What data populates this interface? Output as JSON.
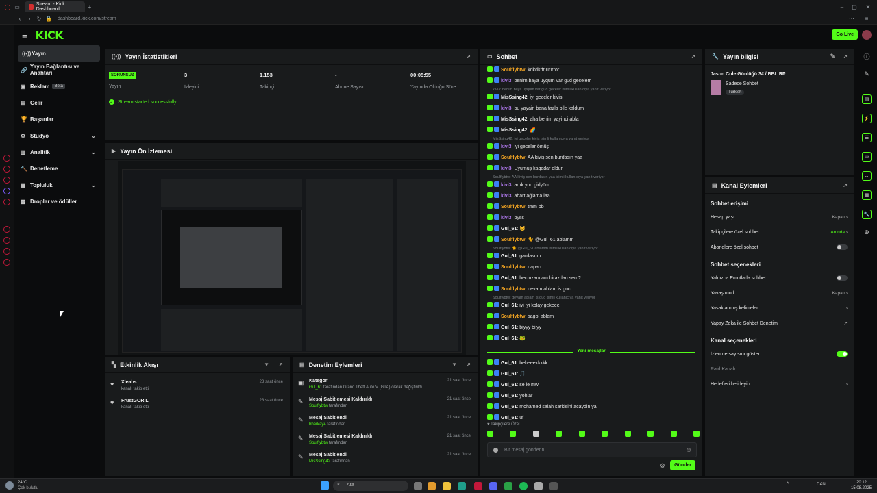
{
  "browser": {
    "tab_title": "Stream - Kick Dashboard",
    "url": "dashboard.kick.com/stream"
  },
  "header": {
    "logo": "KICK",
    "go_live": "Go Live"
  },
  "nav": [
    {
      "label": "Yayın",
      "icon": "stream-icon"
    },
    {
      "label": "Yayın Bağlantısı ve Anahtarı",
      "icon": "link-icon"
    },
    {
      "label": "Reklam",
      "icon": "ad-icon",
      "badge": "Beta"
    },
    {
      "label": "Gelir",
      "icon": "wallet-icon"
    },
    {
      "label": "Başarılar",
      "icon": "trophy-icon"
    },
    {
      "label": "Stüdyo",
      "icon": "studio-icon"
    },
    {
      "label": "Analitik",
      "icon": "analytics-icon"
    },
    {
      "label": "Denetleme",
      "icon": "moderation-icon"
    },
    {
      "label": "Topluluk",
      "icon": "community-icon"
    },
    {
      "label": "Droplar ve ödüller",
      "icon": "gift-icon"
    }
  ],
  "stats": {
    "title": "Yayın İstatistikleri",
    "status_badge": "SORUNSUZ",
    "status_label": "Yayın",
    "viewers": "3",
    "viewers_label": "İzleyici",
    "followers": "1.153",
    "followers_label": "Takipçi",
    "subs": "-",
    "subs_label": "Abone Sayısı",
    "uptime": "00:05:55",
    "uptime_label": "Yayında Olduğu Süre",
    "success": "Stream started successfully."
  },
  "preview": {
    "title": "Yayın Ön İzlemesi"
  },
  "activity": {
    "title": "Etkinlik Akışı",
    "items": [
      {
        "name": "Xleahs",
        "sub": "kanalı takip etti",
        "time": "23 saat önce"
      },
      {
        "name": "FrustGORIL",
        "sub": "kanalı takip etti",
        "time": "23 saat önce"
      }
    ]
  },
  "moderation": {
    "title": "Denetim Eylemleri",
    "items": [
      {
        "title": "Kategori",
        "user": "Gul_61",
        "sub": "tarafından Grand Theft Auto V (GTA) olarak değiştirildi",
        "time": "21 saat önce"
      },
      {
        "title": "Mesaj Sabitlemesi Kaldırıldı",
        "user": "Soulflybtw",
        "sub": "tarafından",
        "time": "21 saat önce"
      },
      {
        "title": "Mesaj Sabitlendi",
        "user": "bbarkay4",
        "sub": "tarafından",
        "time": "21 saat önce"
      },
      {
        "title": "Mesaj Sabitlemesi Kaldırıldı",
        "user": "Soulflybtw",
        "sub": "tarafından",
        "time": "21 saat önce"
      },
      {
        "title": "Mesaj Sabitlendi",
        "user": "MisSsing42",
        "sub": "tarafından",
        "time": "21 saat önce"
      }
    ]
  },
  "chat": {
    "title": "Sohbet",
    "messages": [
      {
        "user": "Soulflybtw",
        "text": "kdkdkdrırırırror",
        "color": "#f5a623"
      },
      {
        "user": "kivi3",
        "text": "benim baya uyqum var gud gecelerr",
        "color": "#b57cf5"
      },
      {
        "reply": "kivi3: benim baya uyqum var gud geceler isimli kullanıcıya yanıt veriyor"
      },
      {
        "user": "MisSsing42",
        "text": "iyi geceler kivis",
        "color": "#f2f2f2"
      },
      {
        "user": "kivi3",
        "text": "bu yayain bana fazla bile kaldum",
        "color": "#b57cf5"
      },
      {
        "user": "MisSsing42",
        "text": "aha benim yayinci abla",
        "color": "#f2f2f2"
      },
      {
        "user": "MisSsing42",
        "text": "🌈",
        "color": "#f2f2f2"
      },
      {
        "reply": "MisSsing42: iyi geceler kivis isimli kullanıcıya yanıt veriyor"
      },
      {
        "user": "kivi3",
        "text": "iyi geceler ömüş",
        "color": "#b57cf5"
      },
      {
        "user": "Soulflybtw",
        "text": "AA kiviş sen burdasın yaa",
        "color": "#f5a623"
      },
      {
        "user": "kivi3",
        "text": "Uyumuş kaqadar oldun",
        "color": "#b57cf5"
      },
      {
        "reply": "Soulflybtw: AA kiviş sen burdasın yaa isimli kullanıcıya yanıt veriyor"
      },
      {
        "user": "kivi3",
        "text": "artık yoq gidyüm",
        "color": "#b57cf5"
      },
      {
        "user": "kivi3",
        "text": "abart ağlama laa",
        "color": "#b57cf5"
      },
      {
        "user": "Soulflybtw",
        "text": "tmm bb",
        "color": "#f5a623"
      },
      {
        "user": "kivi3",
        "text": "byss",
        "color": "#b57cf5"
      },
      {
        "user": "Gul_61",
        "text": "🐱",
        "color": "#f2f2f2"
      },
      {
        "user": "Soulflybtw",
        "text": "🐈 @Gul_61 ablamm",
        "color": "#f5a623"
      },
      {
        "reply": "Soulflybtw: 🐈 @Gul_61 ablamm isimli kullanıcıya yanıt veriyor"
      },
      {
        "user": "Gul_61",
        "text": "gardasum",
        "color": "#f2f2f2"
      },
      {
        "user": "Soulflybtw",
        "text": "napan",
        "color": "#f5a623"
      },
      {
        "user": "Gul_61",
        "text": "hec uzancam birazdan sen ?",
        "color": "#f2f2f2"
      },
      {
        "user": "Soulflybtw",
        "text": "devam ablam is guc",
        "color": "#f5a623"
      },
      {
        "reply": "Soulflybtw: devam ablam is guc isimli kullanıcıya yanıt veriyor"
      },
      {
        "user": "Gul_61",
        "text": "iyi iyi kolay gekeee",
        "color": "#f2f2f2"
      },
      {
        "user": "Soulflybtw",
        "text": "sagol ablam",
        "color": "#f5a623"
      },
      {
        "user": "Gul_61",
        "text": "biyyy biiyy",
        "color": "#f2f2f2"
      },
      {
        "user": "Gul_61",
        "text": "🐸",
        "color": "#f2f2f2"
      }
    ],
    "new_label": "Yeni mesajlar",
    "new_messages": [
      {
        "user": "Gul_61",
        "text": "bebeeekkkkk",
        "color": "#f2f2f2"
      },
      {
        "user": "Gul_61",
        "text": "🎵",
        "color": "#f2f2f2"
      },
      {
        "user": "Gul_61",
        "text": "se le mw",
        "color": "#f2f2f2"
      },
      {
        "user": "Gul_61",
        "text": "yohlar",
        "color": "#f2f2f2"
      },
      {
        "user": "Gul_61",
        "text": "mohamed salah sarkisini acaydin ya",
        "color": "#f2f2f2"
      },
      {
        "user": "Gul_61",
        "text": "üf",
        "color": "#f2f2f2"
      }
    ],
    "followers_only": "Takipçilere Özel",
    "input_placeholder": "Bir mesaj gönderin",
    "send": "Gönder"
  },
  "info": {
    "title": "Yayın bilgisi",
    "stream_title": "Jason Cole Günlüğü 3# / BBL RP",
    "category": "Sadece Sohbet",
    "tag": "Turkish"
  },
  "channel": {
    "title": "Kanal Eylemleri",
    "sec1": "Sohbet erişimi",
    "account_age": "Hesap yaşı",
    "account_age_val": "Kapalı",
    "followers_chat": "Takipçilere özel sohbet",
    "followers_chat_val": "Anında",
    "subs_chat": "Abonelere özel sohbet",
    "sec2": "Sohbet seçenekleri",
    "emotes_only": "Yalnızca Emotlarla sohbet",
    "slow_mode": "Yavaş mod",
    "slow_mode_val": "Kapalı",
    "banned_words": "Yasaklanmış kelimeler",
    "ai_moderation": "Yapay Zeka ile Sohbet Denetimi",
    "sec3": "Kanal seçenekleri",
    "show_viewers": "İzlenme sayısını göster",
    "raid": "Raid Kanalı",
    "goals": "Hedefleri belirleyin"
  },
  "taskbar": {
    "weather_temp": "24°C",
    "weather_desc": "Çok bulutlu",
    "search": "Ara",
    "lang": "DAN",
    "time": "20:12",
    "date": "15.08.2025"
  },
  "colors": {
    "accent": "#53fc18",
    "panel": "#191b1c",
    "bg": "#0b0c0d"
  }
}
